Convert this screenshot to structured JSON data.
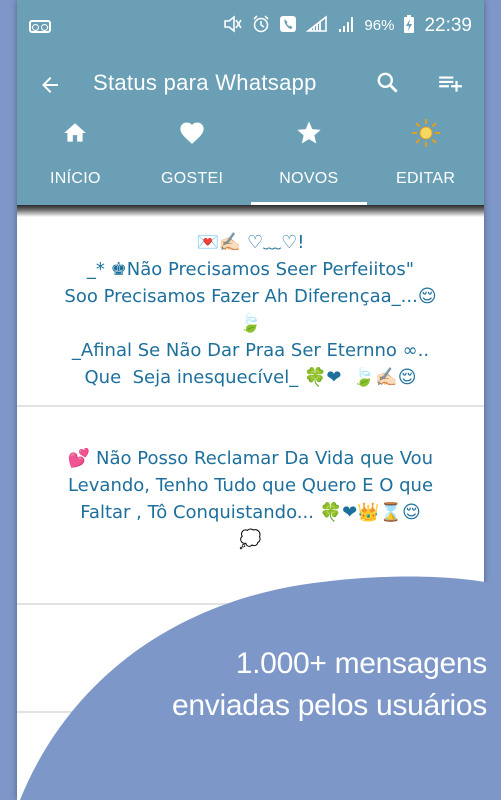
{
  "status_bar": {
    "battery_percent": "96%",
    "time": "22:39"
  },
  "app_bar": {
    "title": "Status para Whatsapp",
    "back_icon": "arrow-left-icon",
    "search_icon": "search-icon",
    "playlist_add_icon": "playlist-add-icon"
  },
  "tabs": [
    {
      "label": "INÍCIO",
      "icon": "home-icon"
    },
    {
      "label": "GOSTEI",
      "icon": "heart-icon"
    },
    {
      "label": "NOVOS",
      "icon": "star-icon",
      "active": true
    },
    {
      "label": "EDITAR",
      "icon": "sun-icon"
    }
  ],
  "messages": [
    {
      "lines": [
        "💌✍🏻 ♡﹏♡!",
        "_* ♚Não Precisamos Seer Perfeiitos\"",
        "Soo Precisamos Fazer Ah Diferençaa_...😌",
        "🍃",
        "_Afinal Se Não Dar Praa Ser Eternno ∞..",
        "Que  Seja inesquecível_ 🍀❤  🍃✍🏻😌"
      ]
    },
    {
      "lines": [
        "💕 Não Posso Reclamar Da Vida que Vou",
        "Levando, Tenho Tudo que Quero E O que",
        "Faltar , Tô Conquistando... 🍀❤👑⌛😌",
        "💭"
      ]
    }
  ],
  "promo": {
    "line1": "1.000+ mensagens",
    "line2": "enviadas pelos usuários"
  },
  "colors": {
    "primary": "#6a9fb5",
    "background": "#7d97c8",
    "message_text": "#1d6f9c"
  }
}
